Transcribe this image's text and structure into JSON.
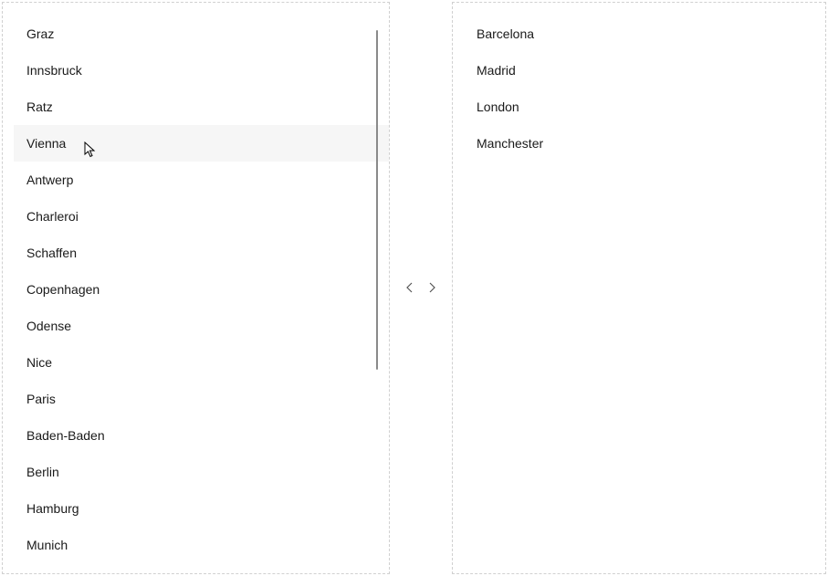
{
  "source_list": {
    "items": [
      {
        "label": "Graz",
        "hovered": false
      },
      {
        "label": "Innsbruck",
        "hovered": false
      },
      {
        "label": "Ratz",
        "hovered": false
      },
      {
        "label": "Vienna",
        "hovered": true
      },
      {
        "label": "Antwerp",
        "hovered": false
      },
      {
        "label": "Charleroi",
        "hovered": false
      },
      {
        "label": "Schaffen",
        "hovered": false
      },
      {
        "label": "Copenhagen",
        "hovered": false
      },
      {
        "label": "Odense",
        "hovered": false
      },
      {
        "label": "Nice",
        "hovered": false
      },
      {
        "label": "Paris",
        "hovered": false
      },
      {
        "label": "Baden-Baden",
        "hovered": false
      },
      {
        "label": "Berlin",
        "hovered": false
      },
      {
        "label": "Hamburg",
        "hovered": false
      },
      {
        "label": "Munich",
        "hovered": false
      }
    ]
  },
  "destination_list": {
    "items": [
      {
        "label": "Barcelona"
      },
      {
        "label": "Madrid"
      },
      {
        "label": "London"
      },
      {
        "label": "Manchester"
      }
    ]
  }
}
